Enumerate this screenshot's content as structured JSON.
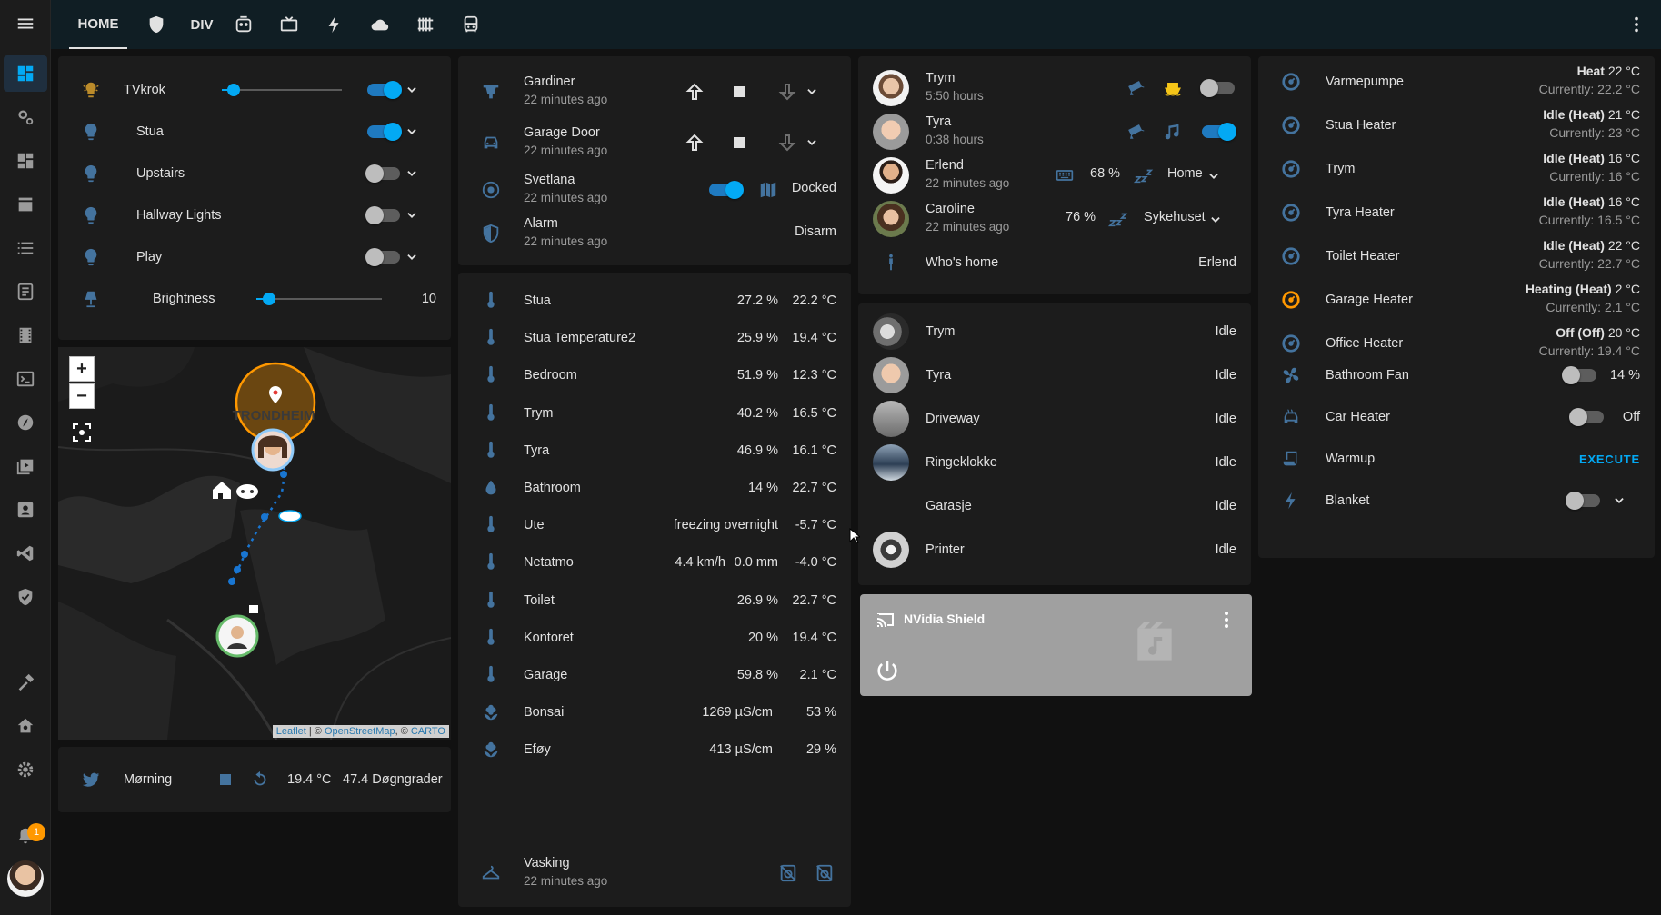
{
  "colors": {
    "accent": "#03a9f4",
    "icon": "#44739e",
    "sidebar_bg": "#1c1c1c",
    "topbar_bg": "#101e24",
    "heating": "#ff9800",
    "tvkrok_icon": "#bb8b2a"
  },
  "topbar": {
    "home_label": "HOME",
    "div_label": "DIV",
    "icons": [
      "shield-icon",
      "robot-vacuum-icon",
      "tv-icon",
      "flash-icon",
      "cloud-icon",
      "radiator-icon",
      "bus-icon"
    ],
    "menu_icon": "dots-vertical-icon"
  },
  "sidebar": {
    "items": [
      "dashboard-icon",
      "cog-box-icon",
      "dashboard-alt-icon",
      "hacs-store-icon",
      "list-icon",
      "logbook-icon",
      "film-icon",
      "terminal-icon",
      "compass-icon",
      "media-icon",
      "account-box-icon",
      "vscode-icon",
      "shield-check-icon",
      "hammer-icon",
      "home-cog-icon",
      "settings-icon"
    ],
    "notification_count": "1"
  },
  "lights": {
    "rows": [
      {
        "name": "TVkrok",
        "on": true,
        "has_slider": true,
        "level": 0.1
      },
      {
        "name": "Stua",
        "on": true
      },
      {
        "name": "Upstairs",
        "on": false
      },
      {
        "name": "Hallway Lights",
        "on": false
      },
      {
        "name": "Play",
        "on": false
      }
    ],
    "brightness": {
      "name": "Brightness",
      "value": "10",
      "level": 0.1
    }
  },
  "map": {
    "zoom_in": "+",
    "zoom_out": "−",
    "city": "TRONDHEIM",
    "attrib_leaflet": "Leaflet",
    "attrib_sep1": " | © ",
    "attrib_osm": "OpenStreetMap",
    "attrib_sep2": ", © ",
    "attrib_carto": "CARTO"
  },
  "morning": {
    "name": "Mørning",
    "temp": "19.4 °C",
    "degree_days": "47.4 Døgngrader"
  },
  "covers": {
    "gardiner": {
      "name": "Gardiner",
      "time": "22 minutes ago"
    },
    "garage": {
      "name": "Garage Door",
      "time": "22 minutes ago"
    },
    "svetlana": {
      "name": "Svetlana",
      "time": "22 minutes ago",
      "state": "Docked"
    },
    "alarm": {
      "name": "Alarm",
      "time": "22 minutes ago",
      "action": "Disarm"
    }
  },
  "sensors": [
    {
      "name": "Stua",
      "v1": "27.2 %",
      "v2": "22.2 °C",
      "icon": "thermometer"
    },
    {
      "name": "Stua Temperature2",
      "v1": "25.9 %",
      "v2": "19.4 °C",
      "icon": "thermometer"
    },
    {
      "name": "Bedroom",
      "v1": "51.9 %",
      "v2": "12.3 °C",
      "icon": "thermometer"
    },
    {
      "name": "Trym",
      "v1": "40.2 %",
      "v2": "16.5 °C",
      "icon": "thermometer"
    },
    {
      "name": "Tyra",
      "v1": "46.9 %",
      "v2": "16.1 °C",
      "icon": "thermometer"
    },
    {
      "name": "Bathroom",
      "v1": "14 %",
      "v2": "22.7 °C",
      "icon": "water"
    },
    {
      "name": "Ute",
      "v1": "freezing overnight",
      "v2": "-5.7 °C",
      "icon": "thermometer"
    },
    {
      "name": "Netatmo",
      "v0": "4.4 km/h",
      "v1": "0.0 mm",
      "v2": "-4.0 °C",
      "icon": "thermometer"
    },
    {
      "name": "Toilet",
      "v1": "26.9 %",
      "v2": "22.7 °C",
      "icon": "thermometer"
    },
    {
      "name": "Kontoret",
      "v1": "20 %",
      "v2": "19.4 °C",
      "icon": "thermometer"
    },
    {
      "name": "Garage",
      "v1": "59.8 %",
      "v2": "2.1 °C",
      "icon": "thermometer"
    },
    {
      "name": "Bonsai",
      "v1": "1269 µS/cm",
      "v2": "53 %",
      "icon": "flower"
    },
    {
      "name": "Eføy",
      "v1": "413 µS/cm",
      "v2": "29 %",
      "icon": "flower"
    }
  ],
  "vasking": {
    "name": "Vasking",
    "time": "22 minutes ago"
  },
  "people": {
    "trym": {
      "name": "Trym",
      "sub": "5:50 hours"
    },
    "tyra": {
      "name": "Tyra",
      "sub": "0:38 hours"
    },
    "erlend": {
      "name": "Erlend",
      "sub": "22 minutes ago",
      "battery": "68 %",
      "zone": "Home"
    },
    "caroline": {
      "name": "Caroline",
      "sub": "22 minutes ago",
      "battery": "76 %",
      "zone": "Sykehuset"
    },
    "whos_home": {
      "name": "Who's home",
      "value": "Erlend"
    }
  },
  "cameras": [
    {
      "name": "Trym",
      "state": "Idle"
    },
    {
      "name": "Tyra",
      "state": "Idle"
    },
    {
      "name": "Driveway",
      "state": "Idle"
    },
    {
      "name": "Ringeklokke",
      "state": "Idle"
    },
    {
      "name": "Garasje",
      "state": "Idle"
    },
    {
      "name": "Printer",
      "state": "Idle"
    }
  ],
  "media": {
    "name": "NVidia Shield"
  },
  "climate": [
    {
      "name": "Varmepumpe",
      "mode": "Heat",
      "target": " 22 °C",
      "current": "Currently: 22.2 °C"
    },
    {
      "name": "Stua Heater",
      "mode": "Idle (Heat)",
      "target": " 21 °C",
      "current": "Currently: 23 °C"
    },
    {
      "name": "Trym",
      "mode": "Idle (Heat)",
      "target": " 16 °C",
      "current": "Currently: 16 °C"
    },
    {
      "name": "Tyra Heater",
      "mode": "Idle (Heat)",
      "target": " 16 °C",
      "current": "Currently: 16.5 °C"
    },
    {
      "name": "Toilet Heater",
      "mode": "Idle (Heat)",
      "target": " 22 °C",
      "current": "Currently: 22.7 °C"
    },
    {
      "name": "Garage Heater",
      "mode": "Heating (Heat)",
      "target": " 2 °C",
      "current": "Currently: 2.1 °C"
    },
    {
      "name": "Office Heater",
      "mode": "Off (Off)",
      "target": " 20 °C",
      "current": "Currently: 19.4 °C"
    }
  ],
  "misc": {
    "fan": {
      "name": "Bathroom Fan",
      "value": "14 %"
    },
    "car": {
      "name": "Car Heater",
      "value": "Off"
    },
    "warmup": {
      "name": "Warmup",
      "action": "EXECUTE"
    },
    "blanket": {
      "name": "Blanket"
    }
  }
}
